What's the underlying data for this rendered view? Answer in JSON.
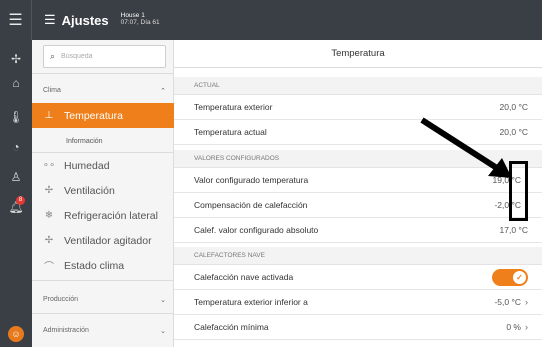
{
  "topbar": {
    "app_title": "Ajustes",
    "house_name": "House 1",
    "house_time": "07:07, Día 61",
    "menu_icon": "hamburger-icon",
    "settings_icon": "sliders-icon"
  },
  "rail": {
    "icons": [
      "fan-icon",
      "barn-icon",
      "thermometer-icon",
      "gauge-icon",
      "person-icon",
      "alarm-bell-icon"
    ],
    "alarm_badge": "8",
    "avatar_icon": "avatar-icon"
  },
  "menu": {
    "search_placeholder": "Búsqueda",
    "sections": {
      "clima": "Clima",
      "produccion": "Producción",
      "administracion": "Administración"
    },
    "items": [
      {
        "label": "Temperatura",
        "icon": "thermometer-icon"
      },
      {
        "label": "Humedad",
        "icon": "droplets-icon"
      },
      {
        "label": "Ventilación",
        "icon": "fan-icon"
      },
      {
        "label": "Refrigeración lateral",
        "icon": "snowflake-icon"
      },
      {
        "label": "Ventilador agitador",
        "icon": "fan-icon"
      },
      {
        "label": "Estado clima",
        "icon": "climate-status-icon"
      }
    ],
    "sub_item": "Información"
  },
  "content": {
    "title": "Temperatura",
    "groups": {
      "actual": "ACTUAL",
      "configurados": "VALORES CONFIGURADOS",
      "calefactores": "CALEFACTORES NAVE"
    },
    "rows": [
      {
        "label": "Temperatura exterior",
        "value": "20,0 °C"
      },
      {
        "label": "Temperatura actual",
        "value": "20,0 °C"
      },
      {
        "label": "Valor configurado temperatura",
        "value": "19,0 °C"
      },
      {
        "label": "Compensación de calefacción",
        "value": "-2,0 °C"
      },
      {
        "label": "Calef. valor configurado absoluto",
        "value": "17,0 °C"
      },
      {
        "label": "Calefacción nave activada",
        "value": "on"
      },
      {
        "label": "Temperatura exterior inferior a",
        "value": "-5,0 °C"
      },
      {
        "label": "Calefacción mínima",
        "value": "0 %"
      }
    ]
  },
  "colors": {
    "accent": "#ef7f1a",
    "dark_bar": "#3a3f45"
  }
}
